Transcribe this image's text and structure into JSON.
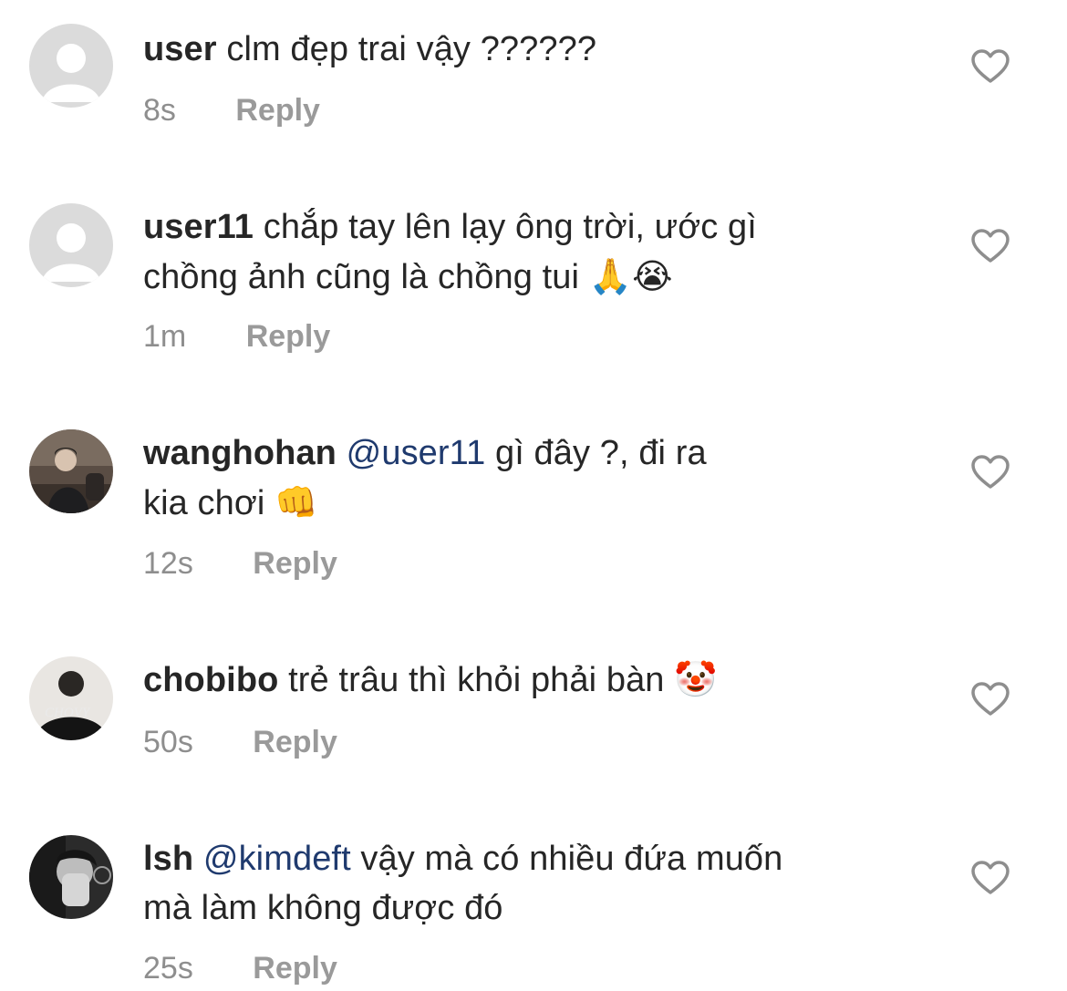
{
  "comments": [
    {
      "username": "user",
      "mention": "",
      "line1": "clm đẹp trai vậy ??????",
      "line2": "",
      "emoji": "",
      "time": "8s",
      "reply_label": "Reply",
      "avatar": "default-avatar"
    },
    {
      "username": "user11",
      "mention": "",
      "line1": "chắp tay lên lạy ông trời, ước gì",
      "line2": "chồng ảnh cũng là chồng tui",
      "emoji": "🙏😭",
      "time": "1m",
      "reply_label": "Reply",
      "avatar": "default-avatar"
    },
    {
      "username": "wanghohan",
      "mention": "@user11",
      "line1": "gì đây ?, đi ra",
      "line2": "kia chơi",
      "emoji": "👊",
      "time": "12s",
      "reply_label": "Reply",
      "avatar": "photo-avatar"
    },
    {
      "username": "chobibo",
      "mention": "",
      "line1": "trẻ trâu thì khỏi phải bàn",
      "line2": "",
      "emoji": "🤡",
      "time": "50s",
      "reply_label": "Reply",
      "avatar": "photo-avatar"
    },
    {
      "username": "lsh",
      "mention": "@kimdeft",
      "line1": "vậy mà có nhiều đứa muốn",
      "line2": "mà làm không được đó",
      "emoji": "",
      "time": "25s",
      "reply_label": "Reply",
      "avatar": "photo-avatar"
    }
  ],
  "colors": {
    "text": "#262626",
    "meta": "#8e8e8e",
    "mention": "#1f3a6e",
    "avatar_placeholder": "#d9d9d9"
  },
  "icons": {
    "like": "heart-outline-icon"
  }
}
